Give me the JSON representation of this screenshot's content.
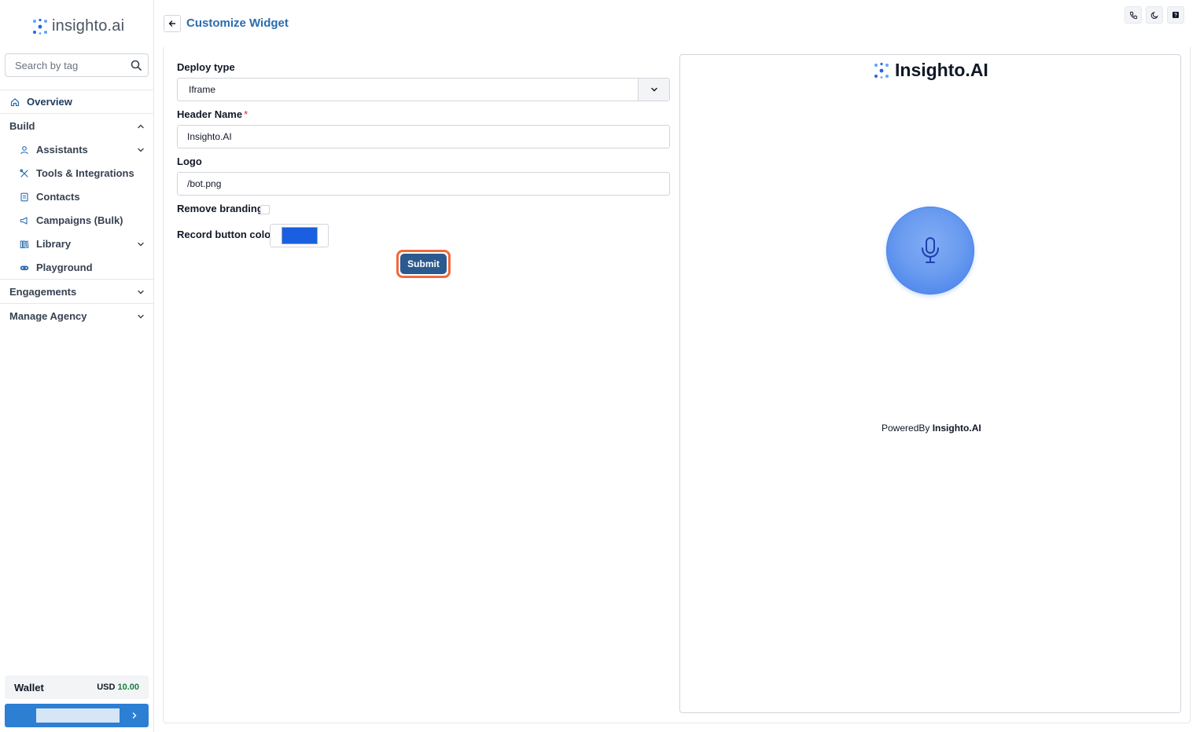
{
  "brand": {
    "name": "insighto.ai"
  },
  "search": {
    "placeholder": "Search by tag"
  },
  "sidebar": {
    "overview": "Overview",
    "build": "Build",
    "build_items": {
      "assistants": "Assistants",
      "tools": "Tools & Integrations",
      "contacts": "Contacts",
      "campaigns": "Campaigns (Bulk)",
      "library": "Library",
      "playground": "Playground"
    },
    "engagements": "Engagements",
    "manage_agency": "Manage Agency"
  },
  "wallet": {
    "label": "Wallet",
    "currency": "USD",
    "amount": "10.00"
  },
  "header": {
    "title": "Customize Widget"
  },
  "form": {
    "deploy_type_label": "Deploy type",
    "deploy_type_value": "Iframe",
    "header_name_label": "Header Name",
    "header_name_required": "*",
    "header_name_value": "Insighto.AI",
    "logo_label": "Logo",
    "logo_value": "/bot.png",
    "remove_branding_label": "Remove branding",
    "record_color_label": "Record button color",
    "record_color_value": "#1a5fe0",
    "submit_label": "Submit"
  },
  "preview": {
    "title": "Insighto.AI",
    "powered_by": "PoweredBy",
    "powered_brand": "Insighto.AI"
  },
  "colors": {
    "accent": "#2b6cb0",
    "submit": "#2b5a8f",
    "submit_focus_ring": "#f06a3c",
    "wallet_amount": "#15803d",
    "user_button": "#2d7fd3"
  }
}
